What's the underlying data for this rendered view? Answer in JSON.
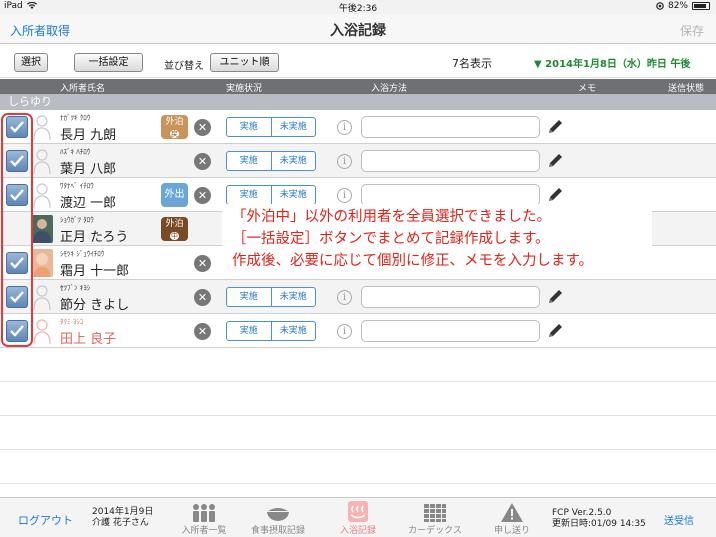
{
  "status_bar": {
    "device": "iPad",
    "time": "午後2:36",
    "battery": "82%"
  },
  "nav": {
    "left": "入所者取得",
    "title": "入浴記録",
    "right": "保存"
  },
  "toolbar": {
    "select_label": "選択",
    "bulk_label": "一括設定",
    "sort_label": "並び替え",
    "unit_label": "ユニット順",
    "count": "7名表示",
    "date": "▼ 2014年1月8日（水）昨日 午後"
  },
  "columns": {
    "name": "入所者氏名",
    "status": "実施状況",
    "method": "入浴方法",
    "memo": "メモ",
    "send": "送信状態"
  },
  "group": "しらゆり",
  "segment": {
    "done": "実施",
    "not_done": "未実施"
  },
  "residents": [
    {
      "kana": "ﾅｶﾞﾂｷ ｸﾛｳ",
      "name": "長月 九朗",
      "checked": true,
      "badge": "外泊",
      "badge_sub": "戻"
    },
    {
      "kana": "ﾊｽﾞｷ ﾊﾁﾛｳ",
      "name": "葉月 八郎",
      "checked": true,
      "badge": "",
      "badge_sub": ""
    },
    {
      "kana": "ﾜﾀﾅﾍﾞ ｲﾁﾛｳ",
      "name": "渡辺 一郎",
      "checked": true,
      "badge": "外出",
      "badge_sub": ""
    },
    {
      "kana": "ｼｮｳｶﾞﾂ ﾀﾛｳ",
      "name": "正月 たろう",
      "checked": false,
      "badge": "外泊",
      "badge_sub": "中"
    },
    {
      "kana": "ｼﾓﾂｷ ｼﾞｭｳｲﾁﾛｳ",
      "name": "霜月 十一郎",
      "checked": true,
      "badge": "",
      "badge_sub": ""
    },
    {
      "kana": "ｾﾂﾌﾞﾝ ｷﾖｼ",
      "name": "節分 きよし",
      "checked": true,
      "badge": "",
      "badge_sub": ""
    },
    {
      "kana": "ﾀｸﾐ ﾖｼｺ",
      "name": "田上 良子",
      "checked": true,
      "badge": "",
      "badge_sub": ""
    }
  ],
  "callout": {
    "line1": "「外泊中」以外の利用者を全員選択できました。",
    "line2": "［一括設定］ボタンでまとめて記録作成します。",
    "line3": "作成後、必要に応じて個別に修正、メモを入力します。"
  },
  "tabbar": {
    "logout": "ログアウト",
    "user_date": "2014年1月9日",
    "user_name": "介護 花子さん",
    "tabs": [
      "入所者一覧",
      "食事摂取記録",
      "入浴記録",
      "カーデックス",
      "申し送り"
    ],
    "version": "FCP Ver.2.5.0",
    "updated": "更新日時:01/09 14:35",
    "receive": "送受信"
  },
  "colors": {
    "accent": "#1a7ad9",
    "date_green": "#1c8a2e",
    "callout_red": "#e2231a",
    "active_tab": "#f27d7d"
  }
}
